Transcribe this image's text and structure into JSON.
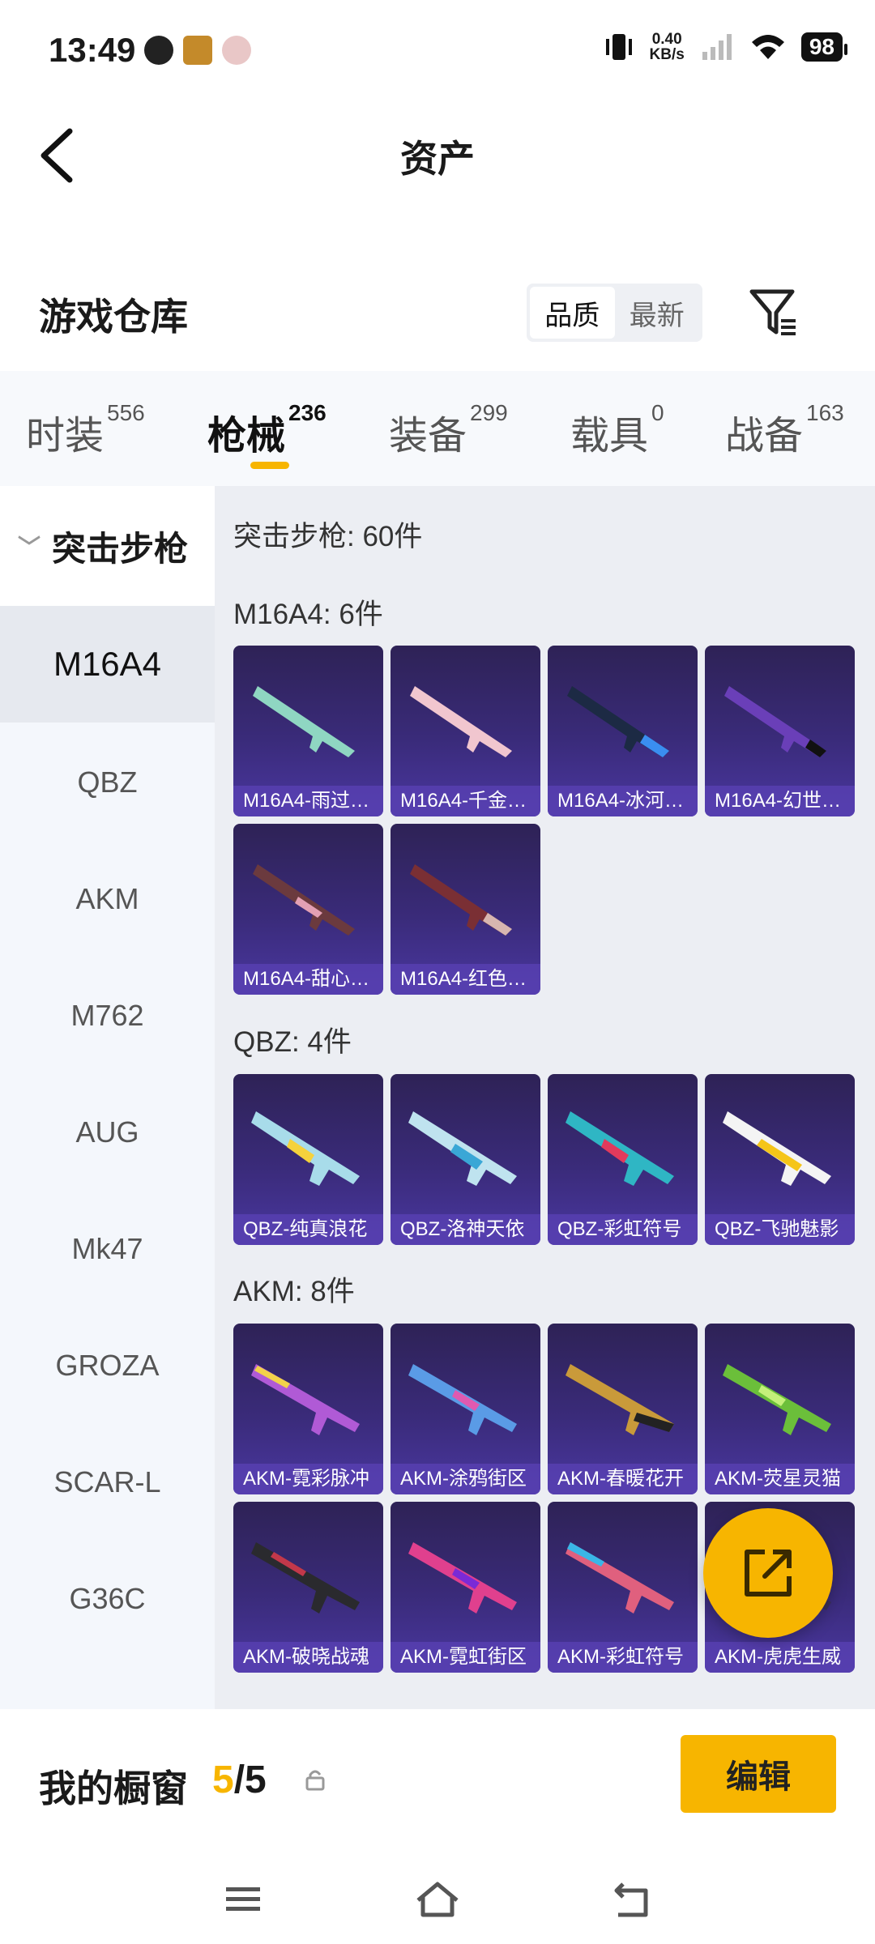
{
  "status_bar": {
    "time": "13:49",
    "net_speed_value": "0.40",
    "net_speed_unit": "KB/s",
    "battery": "98"
  },
  "header": {
    "title": "资产"
  },
  "warehouse": {
    "title": "游戏仓库",
    "sort_options": [
      "品质",
      "最新"
    ],
    "active_sort": "品质"
  },
  "tabs": [
    {
      "label": "时装",
      "count": "556"
    },
    {
      "label": "枪械",
      "count": "236"
    },
    {
      "label": "装备",
      "count": "299"
    },
    {
      "label": "载具",
      "count": "0"
    },
    {
      "label": "战备",
      "count": "163"
    }
  ],
  "sidebar": {
    "group": "突击步枪",
    "items": [
      "M16A4",
      "QBZ",
      "AKM",
      "M762",
      "AUG",
      "Mk47",
      "GROZA",
      "SCAR-L",
      "G36C"
    ]
  },
  "content": {
    "summary": "突击步枪: 60件",
    "sections": [
      {
        "title": "M16A4: 6件",
        "items": [
          "M16A4-雨过…",
          "M16A4-千金…",
          "M16A4-冰河…",
          "M16A4-幻世…",
          "M16A4-甜心…",
          "M16A4-红色…"
        ]
      },
      {
        "title": "QBZ: 4件",
        "items": [
          "QBZ-纯真浪花",
          "QBZ-洛神天依",
          "QBZ-彩虹符号",
          "QBZ-飞驰魅影"
        ]
      },
      {
        "title": "AKM: 8件",
        "items": [
          "AKM-霓彩脉冲",
          "AKM-涂鸦街区",
          "AKM-春暖花开",
          "AKM-荧星灵猫",
          "AKM-破晓战魂",
          "AKM-霓虹街区",
          "AKM-彩虹符号",
          "AKM-虎虎生威"
        ]
      }
    ]
  },
  "showcase": {
    "label": "我的橱窗",
    "current": "5",
    "total": "/5",
    "edit_label": "编辑"
  },
  "colors": {
    "accent": "#f7b500",
    "card_bg": "#3a2b7a"
  }
}
